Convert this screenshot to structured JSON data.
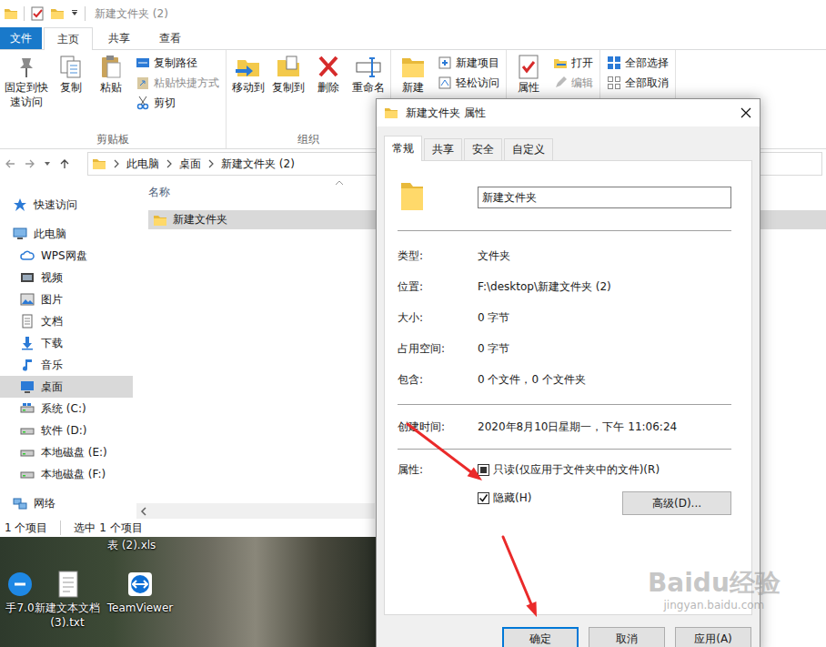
{
  "explorer": {
    "title": "新建文件夹 (2)",
    "ribbon_tabs": [
      {
        "label": "文件",
        "kind": "menu",
        "selected": false
      },
      {
        "label": "主页",
        "kind": "tab",
        "selected": true
      },
      {
        "label": "共享",
        "kind": "tab",
        "selected": false
      },
      {
        "label": "查看",
        "kind": "tab",
        "selected": false
      }
    ],
    "ribbon_groups": [
      {
        "label": "剪贴板",
        "large": [
          {
            "label": "固定到快速访问",
            "disabled": false
          },
          {
            "label": "复制",
            "disabled": false
          },
          {
            "label": "粘贴",
            "disabled": false
          }
        ],
        "small": [
          {
            "label": "复制路径",
            "disabled": false
          },
          {
            "label": "粘贴快捷方式",
            "disabled": true
          },
          {
            "label": "剪切",
            "disabled": false
          }
        ]
      },
      {
        "label": "组织",
        "large": [
          {
            "label": "移动到",
            "disabled": false
          },
          {
            "label": "复制到",
            "disabled": false
          },
          {
            "label": "删除",
            "disabled": false
          },
          {
            "label": "重命名",
            "disabled": false
          }
        ],
        "small": []
      },
      {
        "large": [
          {
            "label": "新建",
            "disabled": false
          }
        ],
        "small": [
          {
            "label": "新建项目",
            "disabled": false
          },
          {
            "label": "轻松访问",
            "disabled": false
          }
        ]
      },
      {
        "large": [
          {
            "label": "属性",
            "disabled": false
          }
        ],
        "small": [
          {
            "label": "打开",
            "disabled": false
          },
          {
            "label": "编辑",
            "disabled": true
          }
        ]
      },
      {
        "large": [],
        "small": [
          {
            "label": "全部选择",
            "disabled": false
          },
          {
            "label": "全部取消",
            "disabled": false
          }
        ]
      }
    ],
    "address": [
      "此电脑",
      "桌面",
      "新建文件夹 (2)"
    ],
    "nav_items": [
      {
        "label": "快速访问",
        "kind": "root",
        "selected": false
      },
      {
        "label": "此电脑",
        "kind": "root",
        "selected": false
      },
      {
        "label": "WPS网盘",
        "kind": "child",
        "selected": false
      },
      {
        "label": "视频",
        "kind": "child",
        "selected": false
      },
      {
        "label": "图片",
        "kind": "child",
        "selected": false
      },
      {
        "label": "文档",
        "kind": "child",
        "selected": false
      },
      {
        "label": "下载",
        "kind": "child",
        "selected": false
      },
      {
        "label": "音乐",
        "kind": "child",
        "selected": false
      },
      {
        "label": "桌面",
        "kind": "child",
        "selected": true
      },
      {
        "label": "系统 (C:)",
        "kind": "child",
        "selected": false
      },
      {
        "label": "软件 (D:)",
        "kind": "child",
        "selected": false
      },
      {
        "label": "本地磁盘 (E:)",
        "kind": "child",
        "selected": false
      },
      {
        "label": "本地磁盘 (F:)",
        "kind": "child",
        "selected": false
      },
      {
        "label": "网络",
        "kind": "root",
        "selected": false
      }
    ],
    "column_header": "名称",
    "files": [
      {
        "name": "新建文件夹",
        "selected": true
      }
    ],
    "status_bar": {
      "count": "1 个项目",
      "selection": "选中 1 个项目"
    }
  },
  "desktop": {
    "icons": [
      {
        "label": "手7.0"
      },
      {
        "label": "新建文本文档 (3).txt"
      },
      {
        "label": "TeamViewer"
      }
    ],
    "cut_label": "表 (2).xls"
  },
  "dialog": {
    "title": "新建文件夹 属性",
    "tabs": [
      {
        "label": "常规",
        "selected": true
      },
      {
        "label": "共享",
        "selected": false
      },
      {
        "label": "安全",
        "selected": false
      },
      {
        "label": "自定义",
        "selected": false
      }
    ],
    "name": "新建文件夹",
    "info": [
      {
        "label": "类型:",
        "value": "文件夹"
      },
      {
        "label": "位置:",
        "value": "F:\\desktop\\新建文件夹 (2)"
      },
      {
        "label": "大小:",
        "value": "0 字节"
      },
      {
        "label": "占用空间:",
        "value": "0 字节"
      },
      {
        "label": "包含:",
        "value": "0 个文件，0 个文件夹"
      }
    ],
    "created": {
      "label": "创建时间:",
      "value": "2020年8月10日星期一，下午 11:06:24"
    },
    "attributes": {
      "label": "属性:",
      "options": [
        {
          "label": "只读(仅应用于文件夹中的文件)(R)",
          "checked": false,
          "indeterminate": true
        },
        {
          "label": "隐藏(H)",
          "checked": true,
          "indeterminate": false
        }
      ],
      "advanced": "高级(D)..."
    },
    "buttons": [
      {
        "label": "确定",
        "default": true
      },
      {
        "label": "取消",
        "default": false
      },
      {
        "label": "应用(A)",
        "default": false
      }
    ]
  },
  "watermark": {
    "brand": "Baidu经验",
    "url": "jingyan.baidu.com"
  }
}
